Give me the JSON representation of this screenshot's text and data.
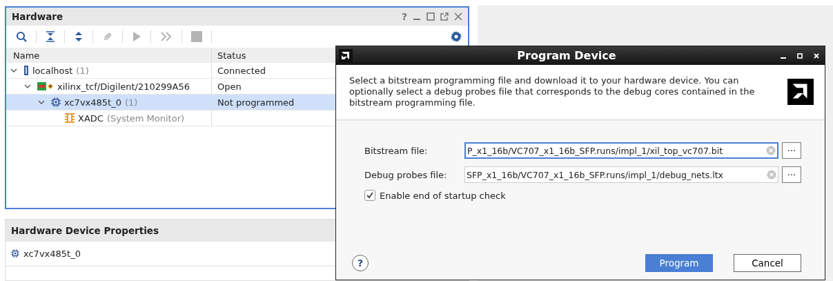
{
  "hardware_panel": {
    "title": "Hardware",
    "help_glyph": "?",
    "toolbar": [
      {
        "kind": "search",
        "disabled": false
      },
      {
        "kind": "collapse",
        "disabled": false
      },
      {
        "kind": "expand",
        "disabled": false
      },
      {
        "kind": "connect",
        "disabled": true
      },
      {
        "kind": "play",
        "disabled": true
      },
      {
        "kind": "fast-forward",
        "disabled": true
      },
      {
        "kind": "stop",
        "disabled": true
      }
    ],
    "columns": [
      "Name",
      "Status"
    ],
    "tree": [
      {
        "kind": "server",
        "label": "localhost",
        "suffix": "(1)",
        "status": "Connected",
        "expanded": true,
        "selected": false,
        "children": [
          {
            "kind": "board",
            "label": "xilinx_tcf/Digilent/210299A56",
            "status": "Open",
            "expanded": true,
            "selected": false,
            "children": [
              {
                "kind": "chip",
                "label": "xc7vx485t_0",
                "suffix": "(1)",
                "status": "Not programmed",
                "expanded": true,
                "selected": true,
                "children": [
                  {
                    "kind": "monitor",
                    "label": "XADC",
                    "suffix": "(System Monitor)",
                    "selected": false
                  }
                ]
              }
            ]
          }
        ]
      }
    ]
  },
  "properties_panel": {
    "title": "Hardware Device Properties",
    "device": "xc7vx485t_0"
  },
  "dialog": {
    "title": "Program Device",
    "description": "Select a bitstream programming file and download it to your hardware device. You can optionally select a debug probes file that corresponds to the debug cores contained in the bitstream programming file.",
    "fields": [
      {
        "label": "Bitstream file:",
        "value": "P_x1_16b/VC707_x1_16b_SFP.runs/impl_1/xil_top_vc707.bit",
        "focused": true,
        "browse": "···"
      },
      {
        "label": "Debug probes file:",
        "value": "SFP_x1_16b/VC707_x1_16b_SFP.runs/impl_1/debug_nets.ltx",
        "focused": false,
        "browse": "···"
      }
    ],
    "checkbox": {
      "label": "Enable end of startup check",
      "checked": true
    },
    "help_glyph": "?",
    "buttons": [
      {
        "label": "Program",
        "primary": true
      },
      {
        "label": "Cancel",
        "primary": false
      }
    ]
  }
}
